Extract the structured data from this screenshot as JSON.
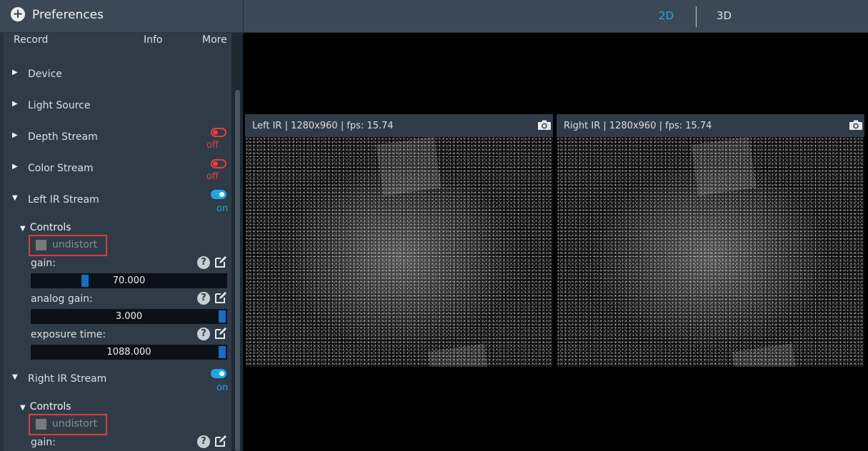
{
  "header": {
    "preferences_label": "Preferences",
    "tabs": [
      {
        "label": "2D",
        "active": true
      },
      {
        "label": "3D",
        "active": false
      }
    ]
  },
  "sidebar": {
    "menu": {
      "record": "Record",
      "info": "Info",
      "more": "More"
    },
    "sections": [
      {
        "label": "Device",
        "expanded": false
      },
      {
        "label": "Light Source",
        "expanded": false
      },
      {
        "label": "Depth Stream",
        "expanded": false,
        "state": "off"
      },
      {
        "label": "Color Stream",
        "expanded": false,
        "state": "off"
      },
      {
        "label": "Left IR Stream",
        "expanded": true,
        "state": "on"
      },
      {
        "label": "Right IR Stream",
        "expanded": true,
        "state": "on"
      }
    ],
    "left_ir": {
      "controls_label": "Controls",
      "undistort_label": "undistort",
      "gain_label": "gain:",
      "gain_value": "70.000",
      "gain_fraction": 0.27,
      "analog_gain_label": "analog gain:",
      "analog_gain_value": "3.000",
      "analog_gain_fraction": 1.0,
      "exposure_label": "exposure time:",
      "exposure_value": "1088.000",
      "exposure_fraction": 1.0
    },
    "right_ir": {
      "controls_label": "Controls",
      "undistort_label": "undistort",
      "gain_label": "gain:"
    }
  },
  "viewers": [
    {
      "title": "Left IR | 1280x960 | fps: 15.74"
    },
    {
      "title": "Right IR | 1280x960 | fps: 15.74"
    }
  ],
  "colors": {
    "accent": "#1ea7e8",
    "off_red": "#ea3c3c",
    "highlight_box": "#e03a3a",
    "slider_thumb": "#1270c8"
  },
  "icons": [
    "plus-icon",
    "caret-right-icon",
    "caret-down-icon",
    "toggle-icon",
    "help-icon",
    "edit-icon",
    "camera-icon"
  ]
}
